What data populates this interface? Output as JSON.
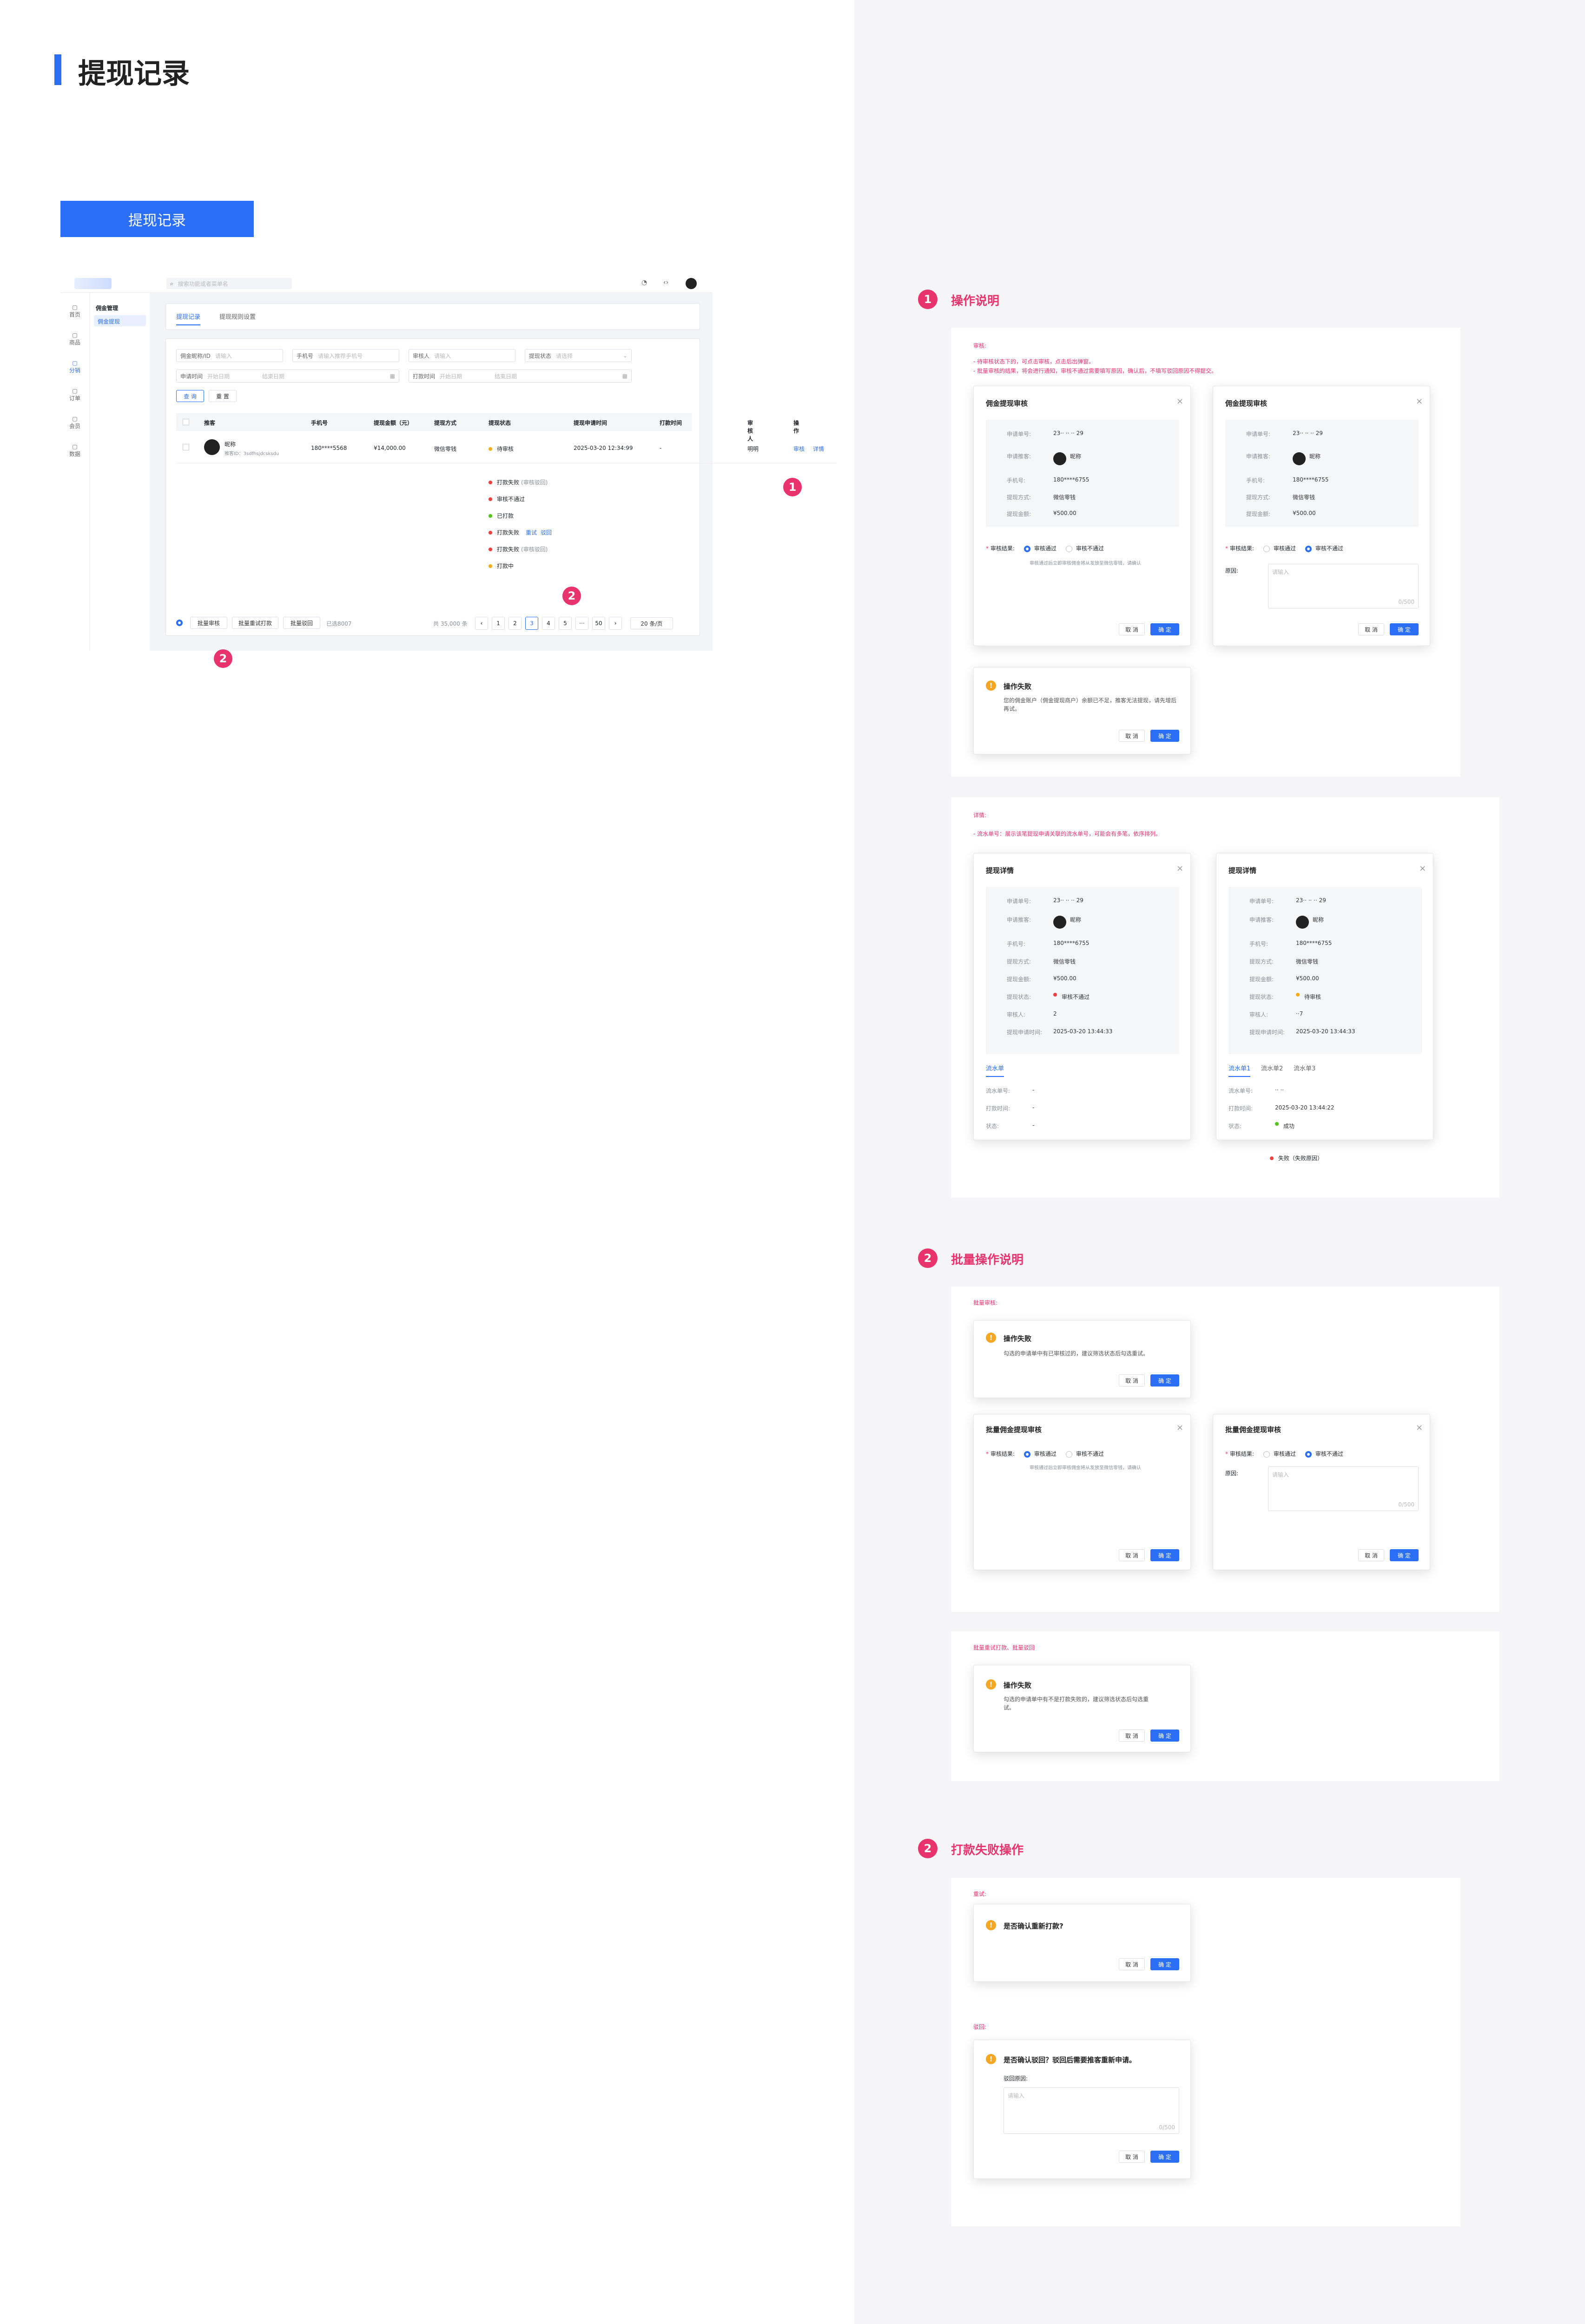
{
  "page": {
    "title": "提现记录",
    "button": "提现记录"
  },
  "app": {
    "search_placeholder": "搜索功能或者菜单名",
    "nav": [
      "首页",
      "商品",
      "分销",
      "订单",
      "会员",
      "数据"
    ],
    "submenu_title": "佣金管理",
    "submenu_item": "佣金提现",
    "tabs": [
      "提现记录",
      "提现规则设置"
    ]
  },
  "filters": {
    "f1": "佣金昵称/ID",
    "f1_ph": "请输入",
    "f2": "手机号",
    "f2_ph": "请输入推荐手机号",
    "f3": "审核人",
    "f3_ph": "请输入",
    "f4": "提现状态",
    "f4_ph": "请选择",
    "f5": "申请时间",
    "f5_ph1": "开始日期",
    "f5_ph2": "结束日期",
    "f6": "打款时间",
    "f6_ph1": "开始日期",
    "f6_ph2": "结束日期",
    "query": "查 询",
    "reset": "重 置"
  },
  "table": {
    "headers": [
      "推客",
      "手机号",
      "提现金额（元）",
      "提现方式",
      "提现状态",
      "提现申请时间",
      "打款时间",
      "审核人",
      "操作"
    ],
    "row": {
      "name": "昵称",
      "sub": "推客ID：3sdfhsjdcsksdu",
      "phone": "180****5568",
      "amount": "¥14,000.00",
      "method": "微信零钱",
      "status": "待审核",
      "apply_time": "2025-03-20 12:34:99",
      "pay_time": "-",
      "reviewer": "明明",
      "op1": "审核",
      "op2": "详情"
    }
  },
  "status_list": [
    {
      "t": "打款失败",
      "s": "(审核驳回)",
      "c": "#f04040"
    },
    {
      "t": "审核不通过",
      "s": "",
      "c": "#f04040"
    },
    {
      "t": "已打款",
      "s": "",
      "c": "#52c41a"
    },
    {
      "t": "打款失败",
      "s": "",
      "c": "#f04040",
      "l1": "重试",
      "l2": "驳回"
    },
    {
      "t": "打款失败",
      "s": "(审核驳回)",
      "c": "#f04040"
    },
    {
      "t": "打款中",
      "s": "",
      "c": "#faad14"
    }
  ],
  "footer": {
    "b1": "批量审核",
    "b2": "批量重试打款",
    "b3": "批量驳回",
    "selected": "已选8007",
    "total": "共 35,000 条",
    "pages": [
      "1",
      "2",
      "3",
      "4",
      "5",
      "···",
      "50"
    ],
    "per": "20 条/页"
  },
  "sections": {
    "s1": "操作说明",
    "s2": "批量操作说明",
    "s3": "打款失败操作"
  },
  "notes": {
    "audit_label": "审核:",
    "audit_1": "- 待审核状态下的，可点击审核，点击后出弹窗。",
    "audit_2": "- 批量审核的结果，将会进行通知，审核不通过需要填写原因，确认后，不填写驳回原因不得提交。",
    "detail_label": "详情:",
    "detail_1": "- 流水单号：展示该笔提现申请关联的流水单号，可能会有多笔，依序排列。",
    "batch_label": "批量审核:",
    "batch2_label": "批量重试打款、批量驳回",
    "retry_label": "重试:",
    "reject_label": "驳回:"
  },
  "dlg": {
    "audit_title": "佣金提现审核",
    "batch_title": "批量佣金提现审核",
    "detail_title": "提现详情",
    "k_no": "申请单号:",
    "k_user": "申请推客:",
    "k_phone": "手机号:",
    "k_method": "提现方式:",
    "k_amount": "提现金额:",
    "k_state": "提现状态:",
    "k_reviewer": "审核人:",
    "k_apply": "提现申请时间:",
    "v_no": "23·· ·· ·· 29",
    "v_user": "昵称",
    "v_uid": "推客ID：3in··· ··e",
    "v_phone": "180****6755",
    "v_method": "微信零钱",
    "v_amount": "¥500.00",
    "v_apply": "2025-03-20 13:44:33",
    "v_state1": "审核不通过",
    "v_state2": "待审核",
    "v_rev1": "2",
    "v_rev2": "··7",
    "result": "审核结果:",
    "pass": "审核通过",
    "fail": "审核不通过",
    "note": "审核通过后立即审核佣金将从发放至微信零钱，请确认",
    "reason": "原因:",
    "reason_ph": "请输入",
    "cnt": "0/500",
    "cancel": "取 消",
    "ok": "确 定",
    "flow": "流水单",
    "flow1": "流水单1",
    "flow2": "流水单2",
    "flow3": "流水单3",
    "k_flow": "流水单号:",
    "k_paytime": "打款时间:",
    "k_state2": "状态:",
    "v_dash": "-",
    "v_flow": "·· ··",
    "v_paytime": "2025-03-20 13:44:22",
    "v_success": "成功",
    "v_failnote": "失败（失败原因）",
    "fail_title": "操作失败",
    "fail_msg": "您的佣金账户（佣金提现商户）余额已不足，推客无法提现，请先增后再试。",
    "batch_fail_msg": "勾选的申请单中有已审核过的，建议筛选状态后勾选重试。",
    "batch_fail_msg2": "勾选的申请单中有不是打款失败的，建议筛选状态后勾选重试。",
    "retry_q": "是否确认重新打款?",
    "reject_q": "是否确认驳回？驳回后需要推客重新申请。",
    "reject_reason": "驳回原因:"
  }
}
